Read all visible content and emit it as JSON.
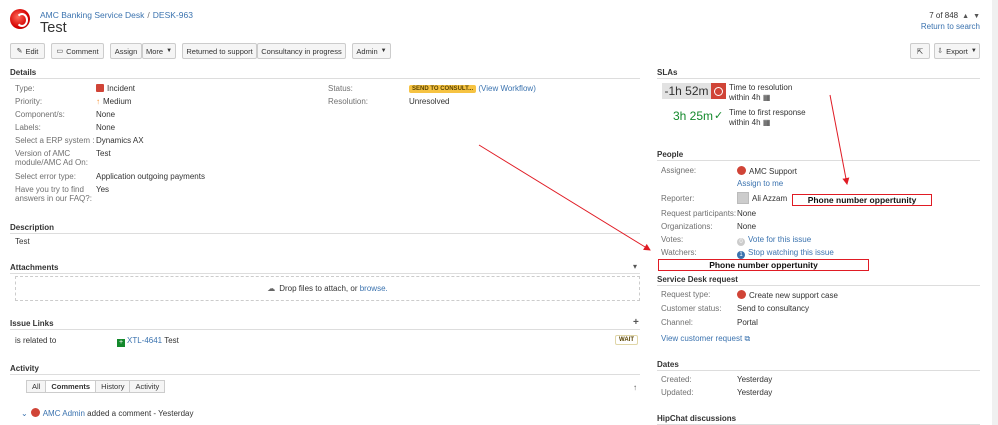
{
  "header": {
    "project": "AMC Banking Service Desk",
    "separator": "/",
    "issue_key": "DESK-963",
    "title": "Test",
    "pager": "7 of 848",
    "return_link": "Return to search"
  },
  "toolbar": {
    "edit": "Edit",
    "comment": "Comment",
    "assign": "Assign",
    "more": "More",
    "returned": "Returned to support",
    "consultancy": "Consultancy in progress",
    "admin": "Admin",
    "export": "Export"
  },
  "details": {
    "heading": "Details",
    "type_label": "Type:",
    "type_value": "Incident",
    "priority_label": "Priority:",
    "priority_value": "Medium",
    "components_label": "Component/s:",
    "components_value": "None",
    "labels_label": "Labels:",
    "labels_value": "None",
    "erp_label": "Select a ERP system :",
    "erp_value": "Dynamics AX",
    "version_label": "Version of AMC module/AMC Ad On:",
    "version_value": "Test",
    "error_label": "Select error type:",
    "error_value": "Application outgoing payments",
    "faq_label": "Have you try to find answers in our FAQ?:",
    "faq_value": "Yes",
    "status_label": "Status:",
    "status_value": "SEND TO CONSULT...",
    "view_workflow": "(View Workflow)",
    "resolution_label": "Resolution:",
    "resolution_value": "Unresolved"
  },
  "description": {
    "heading": "Description",
    "text": "Test"
  },
  "attachments": {
    "heading": "Attachments",
    "drop_text": "Drop files to attach, or",
    "browse": "browse."
  },
  "issue_links": {
    "heading": "Issue Links",
    "relation": "is related to",
    "linked_key": "XTL-4641",
    "linked_title": "Test",
    "linked_status": "WAIT"
  },
  "activity": {
    "heading": "Activity",
    "tabs": [
      "All",
      "Comments",
      "History",
      "Activity"
    ],
    "comment_author": "AMC Admin",
    "comment_text": "added a comment - Yesterday"
  },
  "slas": {
    "heading": "SLAs",
    "sla1_time": "-1h 52m",
    "sla1_name": "Time to resolution",
    "sla1_within": "within 4h",
    "sla2_time": "3h 25m",
    "sla2_name": "Time to first response",
    "sla2_within": "within 4h"
  },
  "people": {
    "heading": "People",
    "assignee_label": "Assignee:",
    "assignee_value": "AMC Support",
    "assign_to_me": "Assign to me",
    "reporter_label": "Reporter:",
    "reporter_value": "Ali Azzam",
    "participants_label": "Request participants:",
    "participants_value": "None",
    "organizations_label": "Organizations:",
    "organizations_value": "None",
    "votes_label": "Votes:",
    "votes_count": "0",
    "votes_link": "Vote for this issue",
    "watchers_label": "Watchers:",
    "watchers_count": "1",
    "watchers_link": "Stop watching this issue"
  },
  "service_desk": {
    "heading": "Service Desk request",
    "request_type_label": "Request type:",
    "request_type_value": "Create new support case",
    "customer_status_label": "Customer status:",
    "customer_status_value": "Send to consultancy",
    "channel_label": "Channel:",
    "channel_value": "Portal",
    "view_request": "View customer request"
  },
  "dates": {
    "heading": "Dates",
    "created_label": "Created:",
    "created_value": "Yesterday",
    "updated_label": "Updated:",
    "updated_value": "Yesterday"
  },
  "hipchat": {
    "heading": "HipChat discussions"
  },
  "annotations": {
    "note1": "Phone number oppertunity",
    "note2": "Phone number oppertunity"
  },
  "colors": {
    "link": "#3b73af",
    "annotation": "#e01b24",
    "sla_breach": "#d04437",
    "sla_ok": "#14892c"
  }
}
